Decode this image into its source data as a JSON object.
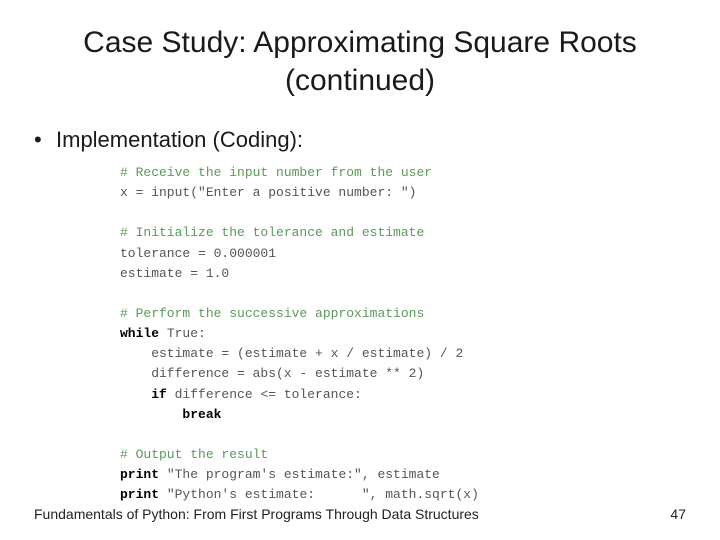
{
  "title": "Case Study: Approximating Square Roots (continued)",
  "bullet": "Implementation (Coding):",
  "code": {
    "c1": "# Receive the input number from the user",
    "l1": "x = input(\"Enter a positive number: \")",
    "c2": "# Initialize the tolerance and estimate",
    "l2": "tolerance = 0.000001",
    "l3": "estimate = 1.0",
    "c3": "# Perform the successive approximations",
    "kw_while": "while",
    "l4": " True:",
    "l5": "    estimate = (estimate + x / estimate) / 2",
    "l6": "    difference = abs(x - estimate ** 2)",
    "kw_if": "if",
    "l7_pre": "    ",
    "l7_post": " difference <= tolerance:",
    "kw_break": "break",
    "l8_pre": "        ",
    "c4": "# Output the result",
    "kw_print1": "print",
    "l9": " \"The program's estimate:\", estimate",
    "kw_print2": "print",
    "l10": " \"Python's estimate:      \", math.sqrt(x)"
  },
  "footer_left": "Fundamentals of Python: From First Programs Through Data Structures",
  "footer_right": "47"
}
